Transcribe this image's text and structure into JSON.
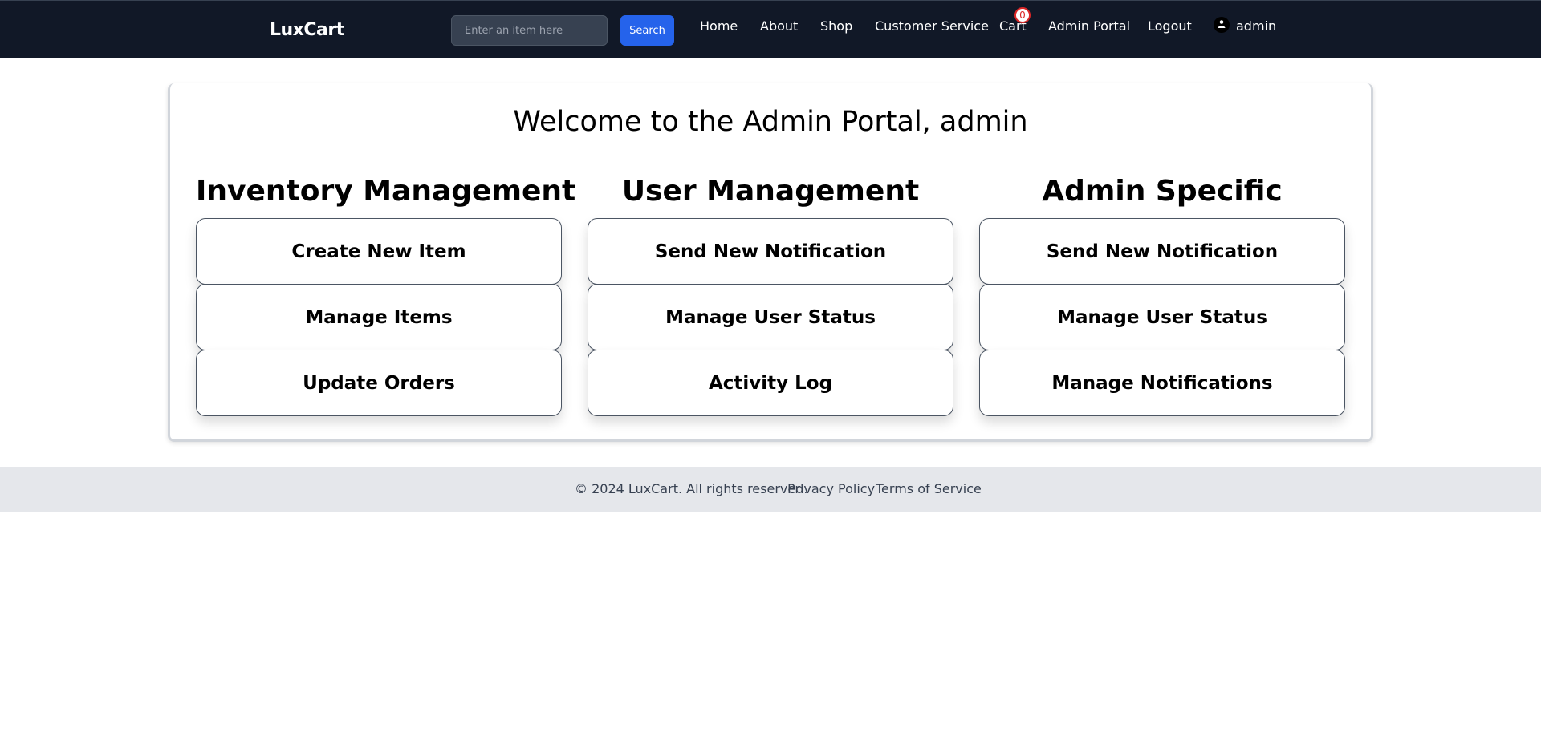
{
  "header": {
    "brand": "LuxCart",
    "search": {
      "placeholder": "Enter an item here",
      "value": "",
      "button_label": "Search"
    },
    "nav": {
      "home": "Home",
      "about": "About",
      "shop": "Shop",
      "customer_service": "Customer Service",
      "cart": "Cart",
      "cart_count": "0",
      "admin_portal": "Admin Portal",
      "logout": "Logout",
      "username": "admin"
    },
    "icons": {
      "user": "user-icon"
    }
  },
  "main": {
    "welcome": "Welcome to the Admin Portal, admin",
    "columns": [
      {
        "title": "Inventory Management",
        "items": [
          "Create New Item",
          "Manage Items",
          "Update Orders"
        ]
      },
      {
        "title": "User Management",
        "items": [
          "Send New Notification",
          "Manage User Status",
          "Activity Log"
        ]
      },
      {
        "title": "Admin Specific",
        "items": [
          "Send New Notification",
          "Manage User Status",
          "Manage Notifications"
        ]
      }
    ]
  },
  "footer": {
    "copyright": "© 2024 LuxCart. All rights reserved.",
    "privacy": "Privacy Policy",
    "terms": "Terms of Service"
  },
  "colors": {
    "navbar_bg": "#111827",
    "accent": "#2563eb",
    "badge": "#dc2626",
    "footer_bg": "#e5e7eb"
  }
}
